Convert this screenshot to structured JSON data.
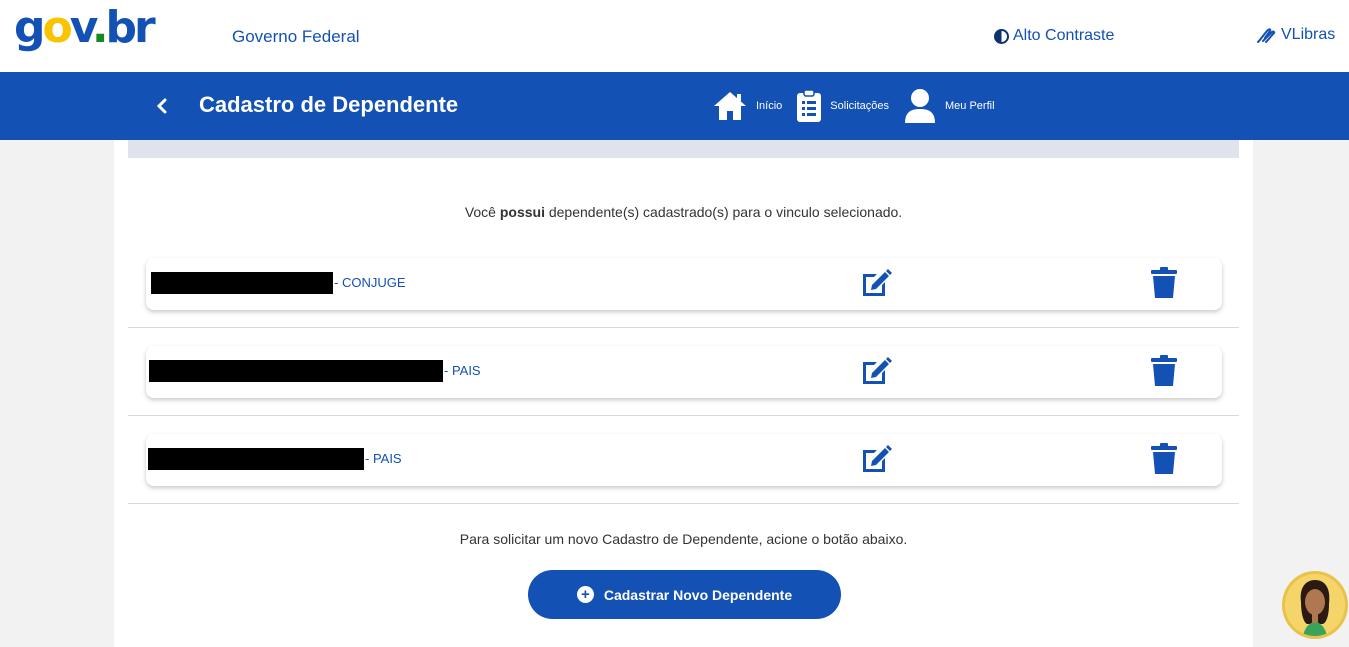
{
  "topbar": {
    "gov_federal": "Governo Federal",
    "contrast_label": "Alto Contraste",
    "vlibras_label": "VLibras"
  },
  "header": {
    "back_icon": "chevron-left-icon",
    "title": "Cadastro de Dependente",
    "nav": [
      {
        "label": "Início",
        "icon": "home-icon"
      },
      {
        "label": "Solicitações",
        "icon": "clipboard-list-icon"
      },
      {
        "label": "Meu Perfil",
        "icon": "user-icon"
      }
    ]
  },
  "main": {
    "info_prefix": "Você ",
    "info_bold": "possui",
    "info_suffix": " dependente(s) cadastrado(s) para o vinculo selecionado.",
    "dependents": [
      {
        "relation": "- CONJUGE"
      },
      {
        "relation": "- PAIS"
      },
      {
        "relation": "- PAIS"
      }
    ],
    "helper_text": "Para solicitar um novo Cadastro de Dependente, acione o botão abaixo.",
    "new_button_label": "Cadastrar Novo Dependente"
  },
  "colors": {
    "primary": "#1351b4",
    "header_bg": "#1351b4",
    "page_bg": "#f2f2f2"
  }
}
